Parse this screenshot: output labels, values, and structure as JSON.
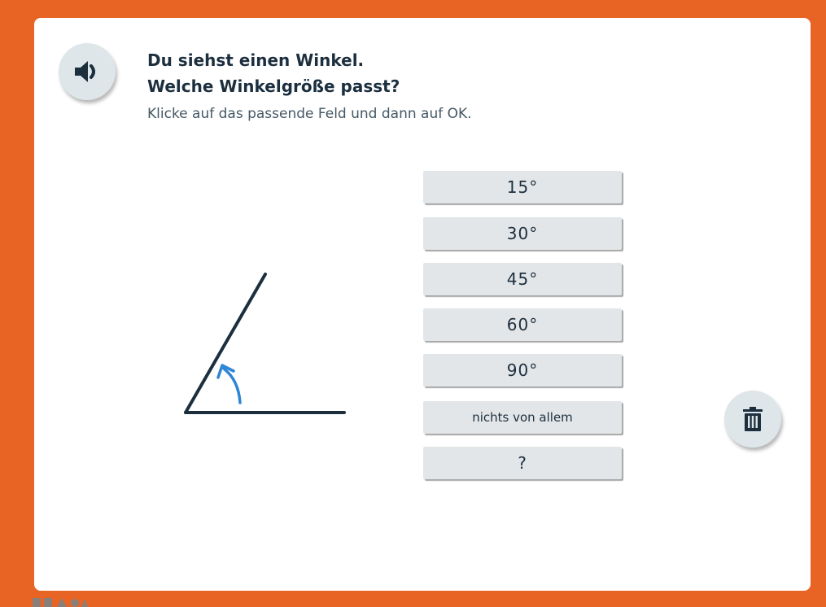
{
  "question": {
    "line1": "Du siehst einen Winkel.",
    "line2": "Welche Winkelgröße passt?",
    "instruction": "Klicke auf das passende Feld und dann auf OK."
  },
  "answers": [
    "15°",
    "30°",
    "45°",
    "60°",
    "90°",
    "nichts von allem",
    "?"
  ],
  "icons": {
    "speaker": "speaker-icon",
    "trash": "trash-icon"
  },
  "colors": {
    "frame": "#e86424",
    "card": "#ffffff",
    "text": "#1c2f3f",
    "angle_arrow": "#2e86d6",
    "button": "#e3e6e8"
  }
}
